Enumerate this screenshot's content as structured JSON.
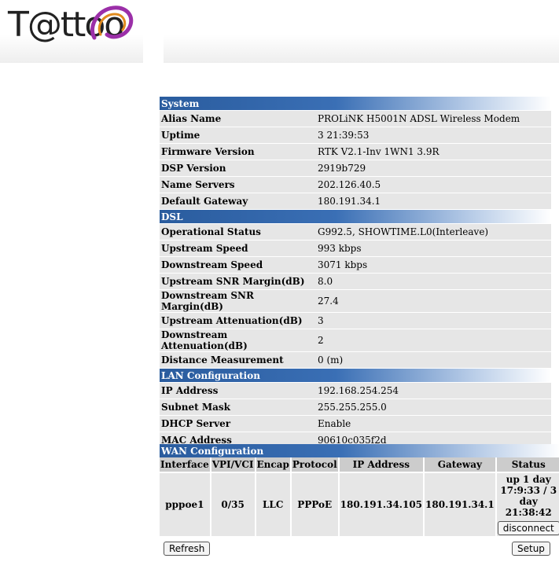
{
  "brand": {
    "logo_text": "T@ttoo"
  },
  "system": {
    "title": "System",
    "rows": [
      {
        "label": "Alias Name",
        "value": "PROLiNK H5001N ADSL Wireless Modem"
      },
      {
        "label": "Uptime",
        "value": "3 21:39:53"
      },
      {
        "label": "Firmware Version",
        "value": "RTK V2.1-Inv 1WN1 3.9R"
      },
      {
        "label": "DSP Version",
        "value": "2919b729"
      },
      {
        "label": "Name Servers",
        "value": "202.126.40.5"
      },
      {
        "label": "Default Gateway",
        "value": "180.191.34.1"
      }
    ]
  },
  "dsl": {
    "title": "DSL",
    "rows": [
      {
        "label": "Operational Status",
        "value": "G992.5, SHOWTIME.L0(Interleave)"
      },
      {
        "label": "Upstream Speed",
        "value": "993 kbps"
      },
      {
        "label": "Downstream Speed",
        "value": "3071 kbps"
      },
      {
        "label": "Upstream SNR Margin(dB)",
        "value": "8.0"
      },
      {
        "label": "Downstream SNR Margin(dB)",
        "value": "27.4"
      },
      {
        "label": "Upstream Attenuation(dB)",
        "value": "3"
      },
      {
        "label": "Downstream Attenuation(dB)",
        "value": "2"
      },
      {
        "label": "Distance Measurement",
        "value": "0 (m)"
      }
    ]
  },
  "lan": {
    "title": "LAN Configuration",
    "rows": [
      {
        "label": "IP Address",
        "value": "192.168.254.254"
      },
      {
        "label": "Subnet Mask",
        "value": "255.255.255.0"
      },
      {
        "label": "DHCP Server",
        "value": "Enable"
      },
      {
        "label": "MAC Address",
        "value": "90610c035f2d"
      }
    ]
  },
  "wan": {
    "title": "WAN Configuration",
    "headers": [
      "Interface",
      "VPI/VCI",
      "Encap",
      "Protocol",
      "IP Address",
      "Gateway",
      "Status"
    ],
    "row": {
      "interface": "pppoe1",
      "vpi_vci": "0/35",
      "encap": "LLC",
      "protocol": "PPPoE",
      "ip": "180.191.34.105",
      "gateway": "180.191.34.1",
      "status_line1": "up 1 day",
      "status_line2": "17:9:33 / 3 day",
      "status_line3": "21:38:42",
      "disconnect_label": "disconnect"
    }
  },
  "buttons": {
    "refresh": "Refresh",
    "setup": "Setup"
  },
  "colors": {
    "section_header": "#2a5c9e",
    "row_bg": "#e6e6e6",
    "wan_header_bg": "#cccccc",
    "logo_swirl": "#9b2fa8"
  }
}
